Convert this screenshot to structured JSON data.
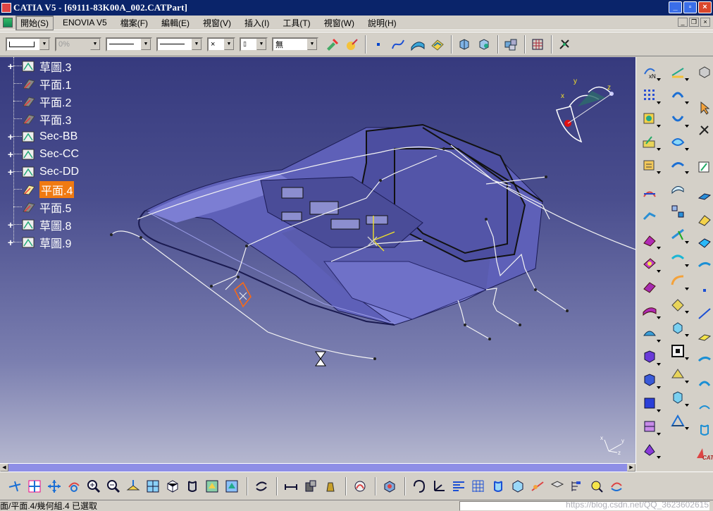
{
  "window": {
    "title": "CATIA V5 - [69111-83K00A_002.CATPart]",
    "controls": [
      "minimize",
      "maximize",
      "close"
    ]
  },
  "menubar": {
    "items": [
      {
        "label": "開始(S)",
        "active": true
      },
      {
        "label": "ENOVIA V5",
        "active": false
      },
      {
        "label": "檔案(F)",
        "active": false
      },
      {
        "label": "編輯(E)",
        "active": false
      },
      {
        "label": "視窗(V)",
        "active": false
      },
      {
        "label": "插入(I)",
        "active": false
      },
      {
        "label": "工具(T)",
        "active": false
      },
      {
        "label": "視窗(W)",
        "active": false
      },
      {
        "label": "說明(H)",
        "active": false
      }
    ]
  },
  "property_toolbar": {
    "transparency_value": "0%",
    "point_type_value": "×",
    "layer_value": "無"
  },
  "spec_tree": {
    "items": [
      {
        "label": "草圖.3",
        "icon": "sketch-icon",
        "expandable": true,
        "selected": false
      },
      {
        "label": "平面.1",
        "icon": "plane-icon",
        "expandable": false,
        "selected": false
      },
      {
        "label": "平面.2",
        "icon": "plane-icon",
        "expandable": false,
        "selected": false
      },
      {
        "label": "平面.3",
        "icon": "plane-icon",
        "expandable": false,
        "selected": false
      },
      {
        "label": "Sec-BB",
        "icon": "sketch-icon",
        "expandable": true,
        "selected": false
      },
      {
        "label": "Sec-CC",
        "icon": "sketch-icon",
        "expandable": true,
        "selected": false
      },
      {
        "label": "Sec-DD",
        "icon": "sketch-icon",
        "expandable": true,
        "selected": false
      },
      {
        "label": "平面.4",
        "icon": "plane-icon",
        "expandable": false,
        "selected": true
      },
      {
        "label": "平面.5",
        "icon": "plane-icon",
        "expandable": false,
        "selected": false
      },
      {
        "label": "草圖.8",
        "icon": "sketch-icon",
        "expandable": true,
        "selected": false
      },
      {
        "label": "草圖.9",
        "icon": "sketch-icon",
        "expandable": true,
        "selected": false
      }
    ]
  },
  "compass": {
    "x_label": "x",
    "y_label": "y",
    "z_label": "z"
  },
  "axis_triad": {
    "x_label": "x",
    "y_label": "y",
    "z_label": "z"
  },
  "status_bar": {
    "text": "面/平面.4/幾何組.4 已選取"
  },
  "watermark": "https://blog.csdn.net/QQ_3623602615",
  "colors": {
    "titlebar": "#0a246a",
    "viewport_top": "#363a7e",
    "viewport_bottom": "#b5b7cf",
    "selected_tree_item": "#f07a12",
    "part_fill": "#6a6cc9"
  }
}
